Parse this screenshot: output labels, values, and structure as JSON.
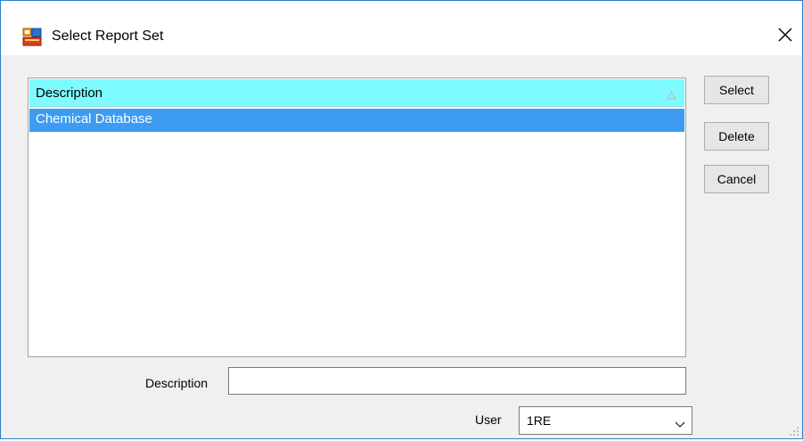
{
  "window": {
    "title": "Select Report Set",
    "app_icon": "report-set-app-icon",
    "close_icon": "close-icon"
  },
  "grid": {
    "columns": [
      "Description"
    ],
    "sort_icon": "sort-ascending-icon",
    "rows": [
      {
        "description": "Chemical Database",
        "selected": true
      }
    ],
    "header_color": "#7dfbff",
    "selected_row_color": "#3d9bf2"
  },
  "buttons": {
    "select": "Select",
    "delete": "Delete",
    "cancel": "Cancel"
  },
  "form": {
    "description_label": "Description",
    "description_value": "",
    "user_label": "User",
    "user_value": "1RE",
    "user_dropdown_icon": "chevron-down-icon"
  },
  "accent_color": "#2b7fd1"
}
